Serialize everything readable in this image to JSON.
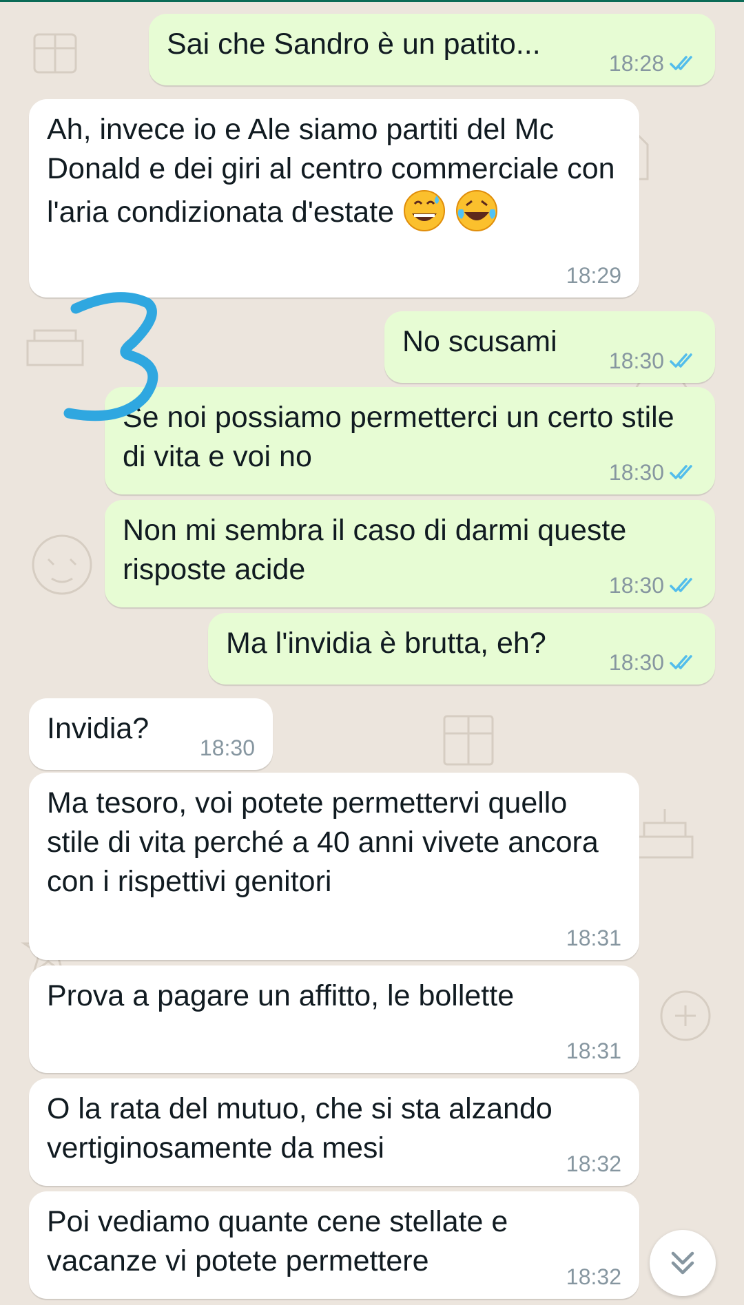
{
  "messages": [
    {
      "dir": "out",
      "text": "Sai che Sandro è un patito...",
      "time": "18:28",
      "ticks": "read"
    },
    {
      "dir": "in",
      "text": "Ah, invece io e Ale siamo partiti del Mc Donald e dei giri al centro commerciale con l'aria condizionata d'estate",
      "emojis": [
        "grinning-sweat-emoji",
        "tears-of-joy-emoji"
      ],
      "time": "18:29"
    },
    {
      "dir": "out",
      "text": "No scusami",
      "time": "18:30",
      "ticks": "read"
    },
    {
      "dir": "out",
      "text": "Se noi possiamo permetterci un certo stile di vita e voi no",
      "time": "18:30",
      "ticks": "read"
    },
    {
      "dir": "out",
      "text": "Non mi sembra il caso di darmi queste risposte acide",
      "time": "18:30",
      "ticks": "read"
    },
    {
      "dir": "out",
      "text": "Ma l'invidia è brutta, eh?",
      "time": "18:30",
      "ticks": "read"
    },
    {
      "dir": "in",
      "text": "Invidia?",
      "time": "18:30"
    },
    {
      "dir": "in",
      "text": "Ma tesoro, voi potete permettervi quello stile di vita perché a 40 anni vivete ancora con i rispettivi genitori",
      "time": "18:31"
    },
    {
      "dir": "in",
      "text": "Prova a pagare un affitto, le bollette",
      "time": "18:31"
    },
    {
      "dir": "in",
      "text": "O la rata del mutuo, che si sta alzando vertiginosamente da mesi",
      "time": "18:32"
    },
    {
      "dir": "in",
      "text": "Poi vediamo quante cene stellate e vacanze vi potete permettere",
      "time": "18:32"
    }
  ],
  "annotation": {
    "text": "3",
    "color": "#2fa7e0"
  },
  "colors": {
    "incoming": "#ffffff",
    "outgoing": "#e7fcd4",
    "wallpaper": "#ece5dd",
    "read_ticks": "#53bdeb",
    "meta": "#8696a0"
  },
  "icons": {
    "scroll_down": "double-chevron-down-icon",
    "read_receipt": "double-check-icon"
  }
}
